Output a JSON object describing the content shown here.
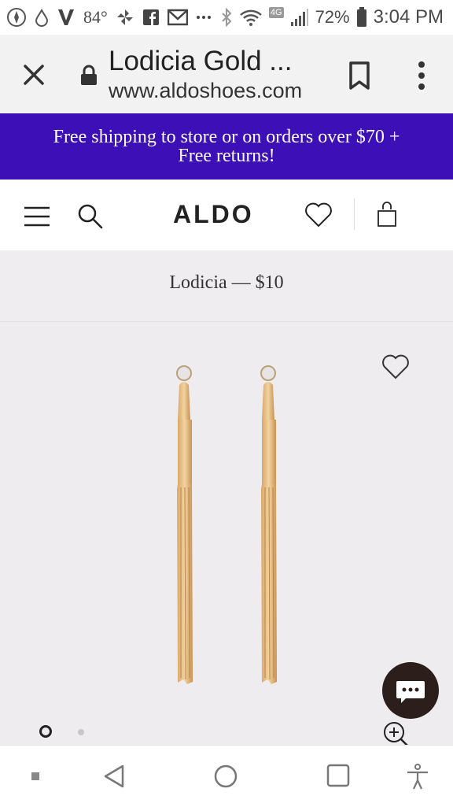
{
  "status_bar": {
    "temperature": "84°",
    "battery_percent": "72%",
    "time": "3:04 PM",
    "network_badge": "4G",
    "icons": [
      "pinwheel-icon",
      "drop-icon",
      "verizon-v-icon",
      "fan-icon",
      "facebook-icon",
      "gmail-icon",
      "more-dots-icon",
      "bluetooth-icon",
      "wifi-icon",
      "signal-icon",
      "battery-icon"
    ]
  },
  "browser": {
    "page_title": "Lodicia Gold ...",
    "url": "www.aldoshoes.com",
    "icons": [
      "close-icon",
      "lock-icon",
      "bookmark-icon",
      "more-vert-icon"
    ]
  },
  "promo": {
    "line1": "Free shipping to store or on orders over $70 +",
    "line2": "Free returns!",
    "color": "#3d0fb7"
  },
  "header": {
    "logo": "ALDO",
    "icons": [
      "menu-icon",
      "search-icon",
      "heart-icon",
      "shopping-bag-icon"
    ]
  },
  "product": {
    "title": "Lodicia — $10",
    "image_description_icons": [
      "wishlist-heart-icon",
      "chat-icon",
      "zoom-in-icon"
    ],
    "carousel": {
      "active_index": 1,
      "total": 2
    }
  },
  "nav_bar": {
    "icons": [
      "square-small-icon",
      "back-icon",
      "home-icon",
      "recents-icon",
      "accessibility-icon"
    ]
  }
}
